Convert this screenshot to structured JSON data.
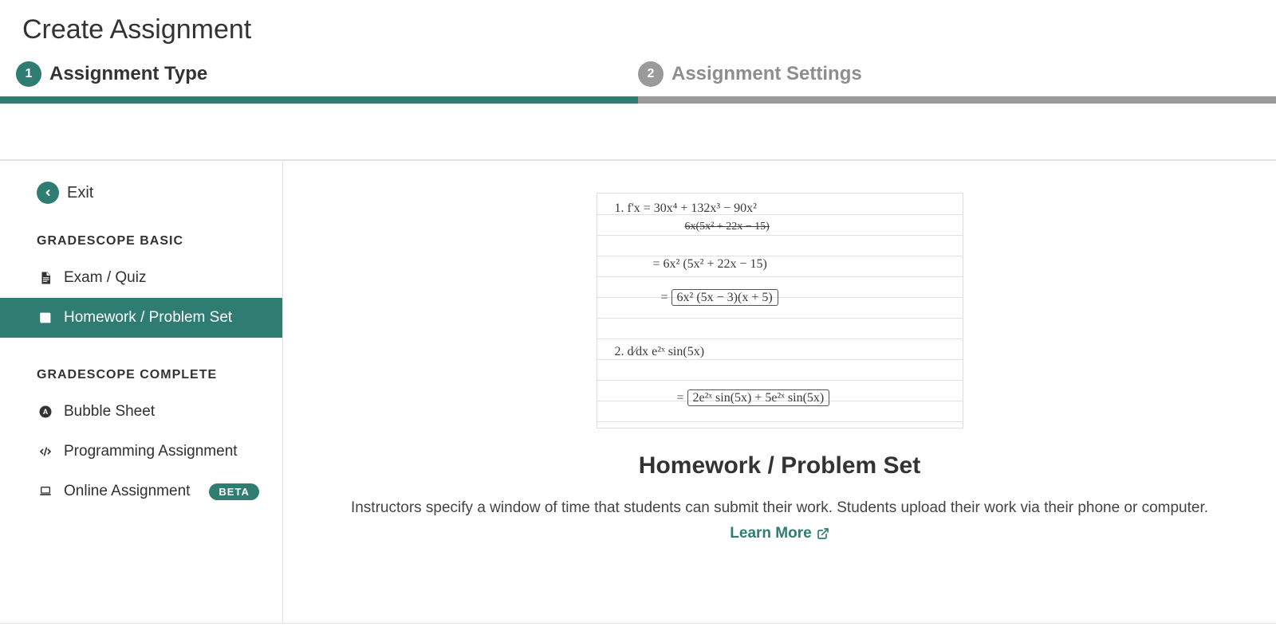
{
  "header": {
    "title": "Create Assignment"
  },
  "steps": [
    {
      "number": "1",
      "label": "Assignment Type",
      "active": true
    },
    {
      "number": "2",
      "label": "Assignment Settings",
      "active": false
    }
  ],
  "sidebar": {
    "exit_label": "Exit",
    "section1_header": "GRADESCOPE BASIC",
    "section2_header": "GRADESCOPE COMPLETE",
    "items": {
      "exam_quiz": "Exam / Quiz",
      "homework": "Homework / Problem Set",
      "bubble_sheet": "Bubble Sheet",
      "programming": "Programming Assignment",
      "online": "Online Assignment",
      "online_badge": "BETA"
    }
  },
  "main": {
    "heading": "Homework / Problem Set",
    "description_part1": "Instructors specify a window of time that students can submit their work. Students upload their work via their phone or computer. ",
    "learn_more": "Learn More"
  },
  "hw_illustration": {
    "row1": "1.  f'x =  30x⁴ + 132x³ − 90x²",
    "row1b": "6x(5x² + 22x − 15)",
    "row2": "=  6x² (5x² + 22x − 15)",
    "row3_prefix": "= ",
    "row3_box": "6x² (5x − 3)(x + 5)",
    "row4": "2.  d⁄dx  e²ˣ sin(5x)",
    "row5_prefix": "= ",
    "row5_box": "2e²ˣ sin(5x) + 5e²ˣ sin(5x)"
  }
}
